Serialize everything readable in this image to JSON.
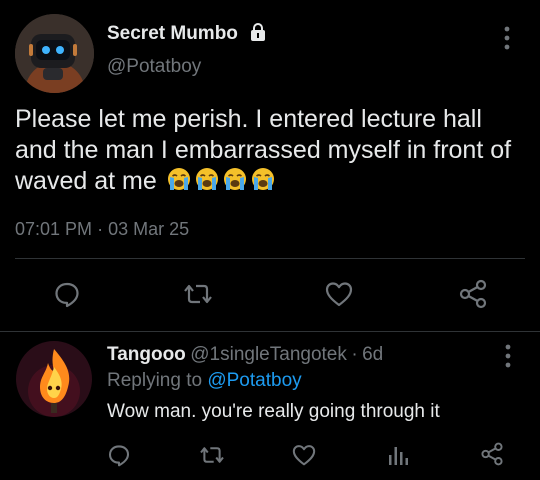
{
  "tweet": {
    "author_name": "Secret Mumbo",
    "author_handle": "@Potatboy",
    "text": "Please let me perish. I entered lecture hall and the man I embarrassed myself in front of waved at me",
    "emojis": [
      "loudly-crying-face",
      "loudly-crying-face",
      "loudly-crying-face",
      "loudly-crying-face"
    ],
    "time": "07:01 PM",
    "separator": "·",
    "date": "03 Mar 25",
    "icons": [
      "reply-icon",
      "retweet-icon",
      "like-icon",
      "share-icon"
    ],
    "more_icon": "more-vertical-icon",
    "lock_icon": "lock-icon"
  },
  "reply": {
    "author_name": "Tangooo",
    "author_handle": "@1singleTangotek",
    "separator": "·",
    "age": "6d",
    "replying_to_label": "Replying to",
    "replying_to_handle": "@Potatboy",
    "text": "Wow man. you're really going through it",
    "icons": [
      "reply-icon",
      "retweet-icon",
      "like-icon",
      "analytics-icon",
      "share-icon"
    ],
    "more_icon": "more-vertical-icon"
  },
  "colors": {
    "background": "#000000",
    "text": "#e7e9ea",
    "muted": "#71767b",
    "link": "#1d9bf0",
    "divider": "#2f3336",
    "emoji_yellow": "#f4c02a",
    "tear_blue": "#4aa8e8"
  }
}
